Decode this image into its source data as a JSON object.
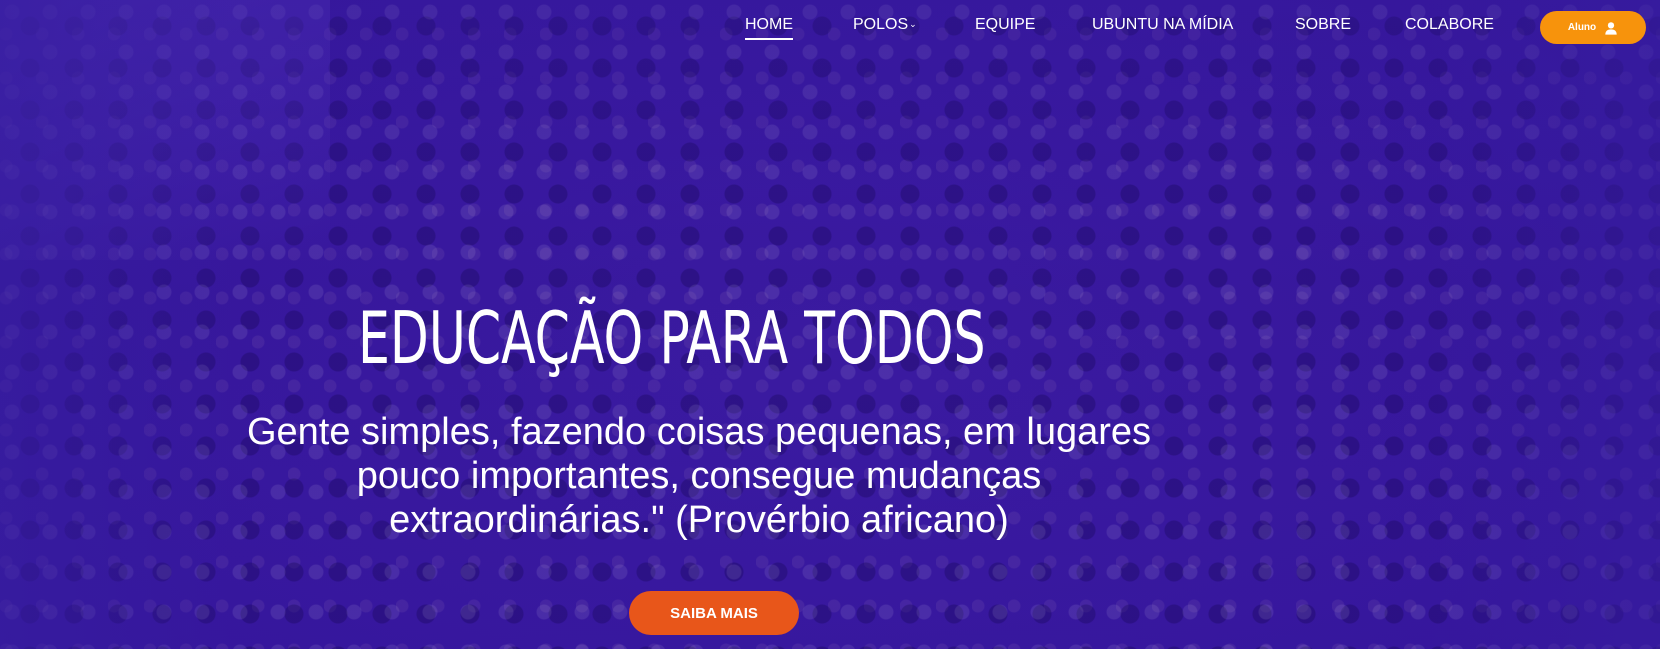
{
  "nav": {
    "items": [
      {
        "label": "HOME",
        "active": true
      },
      {
        "label": "POLOS",
        "has_dropdown": true
      },
      {
        "label": "EQUIPE"
      },
      {
        "label": "UBUNTU NA MÍDIA"
      },
      {
        "label": "SOBRE"
      },
      {
        "label": "COLABORE"
      }
    ],
    "login": {
      "label": "Aluno",
      "icon": "user-icon"
    }
  },
  "hero": {
    "title": "EDUCAÇÃO PARA TODOS",
    "quote": "Gente simples, fazendo coisas pequenas, em lugares pouco importantes, consegue mudanças extraordinárias.\" (Provérbio africano)",
    "cta_label": "SAIBA MAIS"
  },
  "colors": {
    "overlay": "#3a1a9e",
    "login_button": "#f7930c",
    "cta_button": "#e8561a",
    "text": "#ffffff"
  }
}
